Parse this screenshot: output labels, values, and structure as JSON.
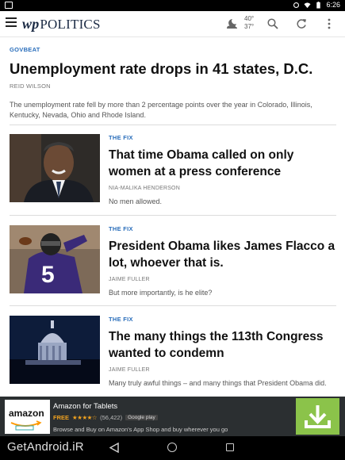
{
  "status_bar": {
    "time": "6:26"
  },
  "app_bar": {
    "logo_mark": "wp",
    "section": "POLITICS",
    "temp_high": "40°",
    "temp_low": "37°",
    "icons": [
      "menu-icon",
      "moon-cloud-icon",
      "search-icon",
      "refresh-icon",
      "more-vert-icon"
    ]
  },
  "lead_story": {
    "kicker": "GOVBEAT",
    "headline": "Unemployment rate drops in 41 states, D.C.",
    "byline": "REID WILSON",
    "dek": "The unemployment rate fell by more than 2 percentage points over the year in Colorado, Illinois, Kentucky, Nevada, Ohio and Rhode Island."
  },
  "stories": [
    {
      "kicker": "THE FIX",
      "headline": "That time Obama called on only women at a press conference",
      "byline": "NIA-MALIKA HENDERSON",
      "dek": "No men allowed."
    },
    {
      "kicker": "THE FIX",
      "headline": "President Obama likes James Flacco a lot, whoever that is.",
      "byline": "JAIME FULLER",
      "dek": "But more importantly, is he elite?"
    },
    {
      "kicker": "THE FIX",
      "headline": "The many things the 113th Congress wanted to condemn",
      "byline": "JAIME FULLER",
      "dek": "Many truly awful things – and many things that President Obama did."
    }
  ],
  "ad": {
    "brand": "amazon",
    "title": "Amazon for Tablets",
    "price": "FREE",
    "stars": "★★★★☆",
    "rating_count": "(56,422)",
    "store_badge": "Google play",
    "description": "Browse and Buy on Amazon's App Shop and buy wherever you go",
    "accent_color": "#8bc34a"
  },
  "watermark": "GetAndroid.iR",
  "colors": {
    "kicker": "#2a6ebb",
    "headline": "#111111",
    "ad_bg": "#2b2f31"
  }
}
